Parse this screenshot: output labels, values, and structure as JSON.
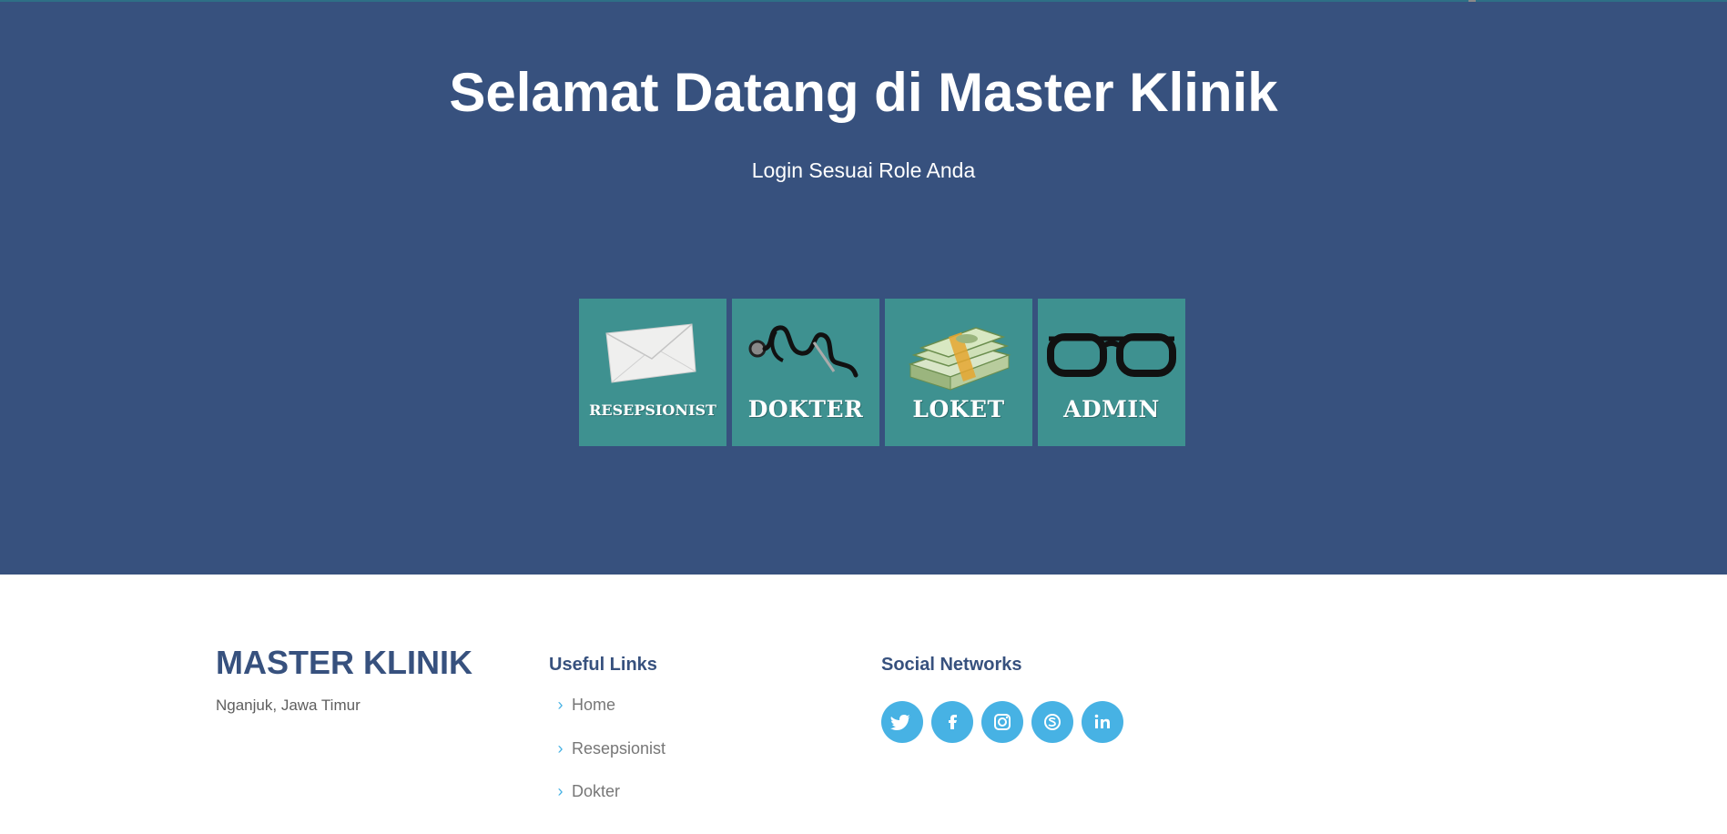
{
  "hero": {
    "title": "Selamat Datang di Master Klinik",
    "subtitle": "Login Sesuai Role Anda",
    "background_color": "#37517e"
  },
  "roles": [
    {
      "label": "RESEPSIONIST",
      "icon": "envelope-icon"
    },
    {
      "label": "DOKTER",
      "icon": "stethoscope-icon"
    },
    {
      "label": "LOKET",
      "icon": "money-stack-icon"
    },
    {
      "label": "ADMIN",
      "icon": "glasses-icon"
    }
  ],
  "footer": {
    "brand": "MASTER KLINIK",
    "address": "Nganjuk, Jawa Timur",
    "useful_links_title": "Useful Links",
    "links": [
      "Home",
      "Resepsionist",
      "Dokter"
    ],
    "social_title": "Social Networks",
    "social": [
      "twitter-icon",
      "facebook-icon",
      "instagram-icon",
      "skype-icon",
      "linkedin-icon"
    ]
  },
  "colors": {
    "tile": "#3e9190",
    "accent": "#47b2e4",
    "brand": "#37517e"
  }
}
